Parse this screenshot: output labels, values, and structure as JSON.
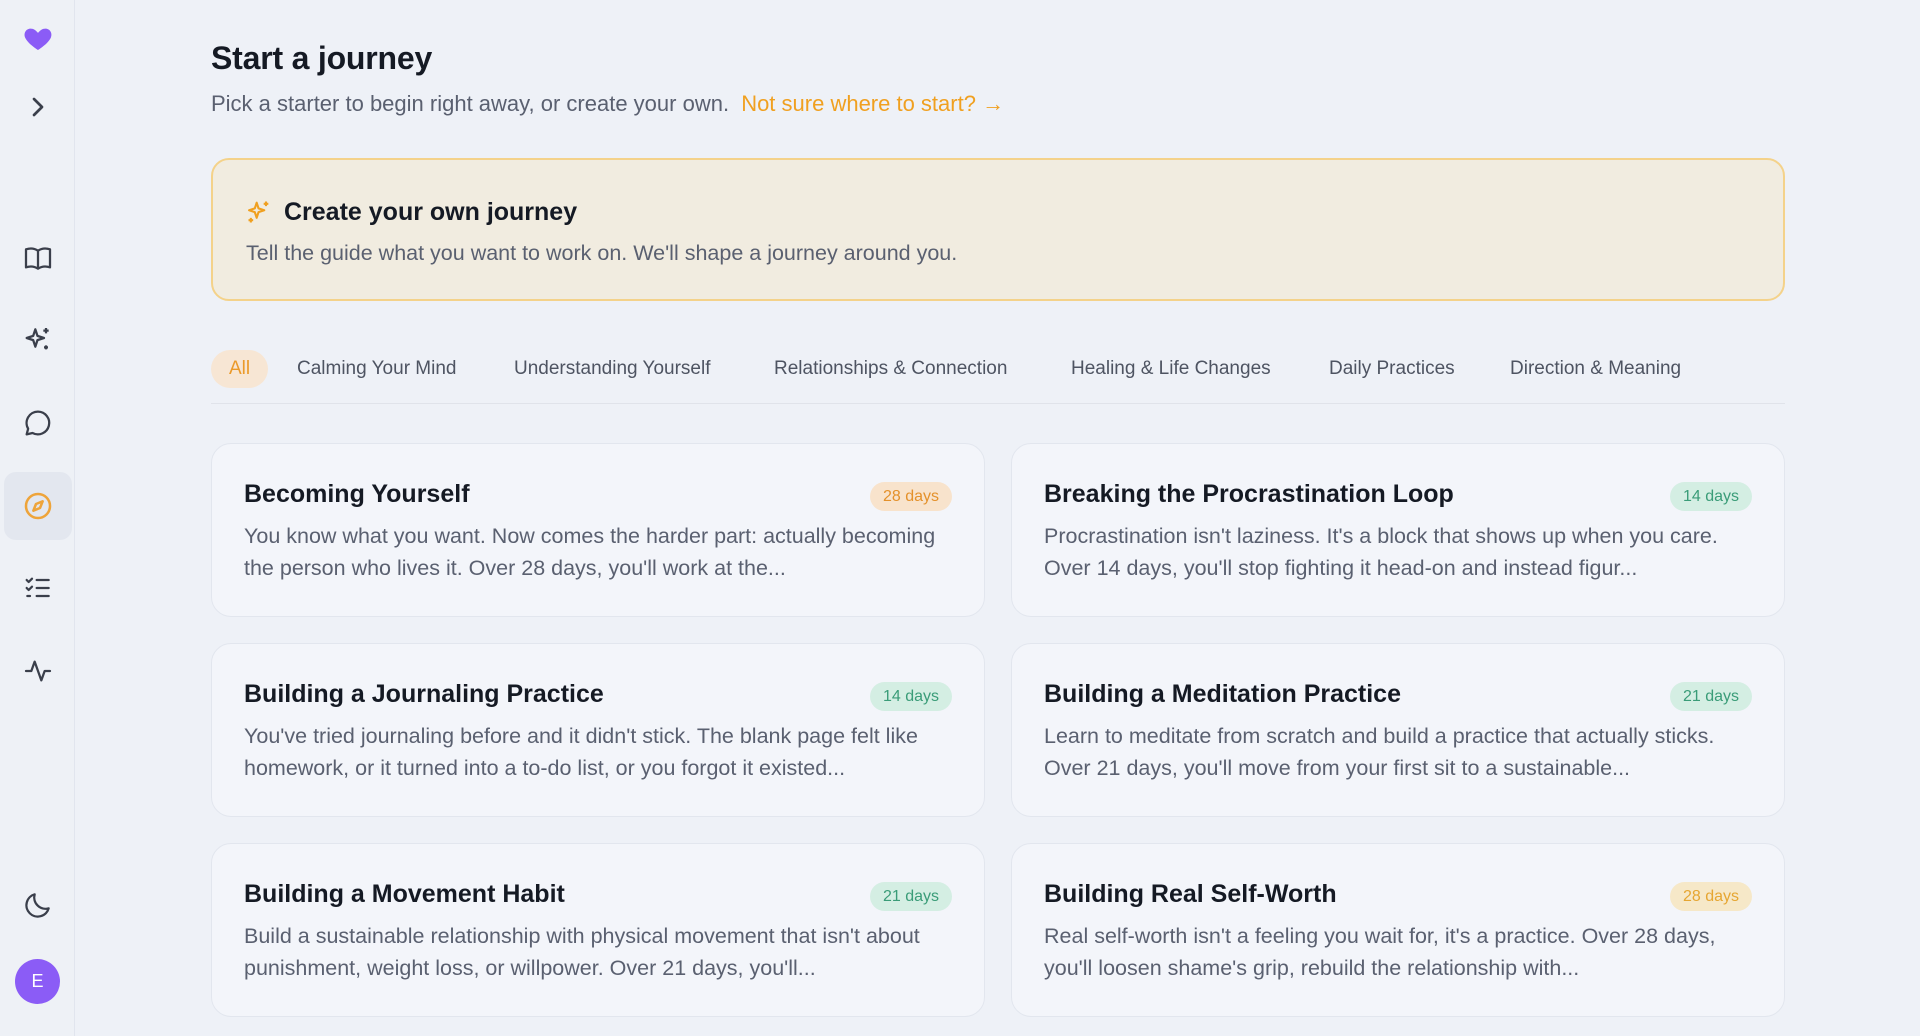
{
  "sidebar": {
    "items": [
      {
        "icon": "heart-logo-icon",
        "color": "#8b5cf6"
      },
      {
        "icon": "chevron-right-icon"
      },
      {
        "icon": "book-open-icon"
      },
      {
        "icon": "sparkles-icon"
      },
      {
        "icon": "chat-bubble-icon"
      },
      {
        "icon": "compass-icon",
        "active": true,
        "color": "#eea43a"
      },
      {
        "icon": "checklist-icon"
      },
      {
        "icon": "activity-icon"
      },
      {
        "icon": "moon-icon"
      }
    ],
    "avatar_initial": "E",
    "avatar_color": "#8b5cf6"
  },
  "header": {
    "title": "Start a journey",
    "subtitle": "Pick a starter to begin right away, or create your own.",
    "help_link": "Not sure where to start? →"
  },
  "create": {
    "title": "Create your own journey",
    "description": "Tell the guide what you want to work on. We'll shape a journey around you.",
    "accent": "#f4d28a"
  },
  "tabs": [
    {
      "label": "All",
      "active": true
    },
    {
      "label": "Calming Your Mind"
    },
    {
      "label": "Understanding Yourself"
    },
    {
      "label": "Relationships & Connection"
    },
    {
      "label": "Healing & Life Changes"
    },
    {
      "label": "Daily Practices"
    },
    {
      "label": "Direction & Meaning"
    }
  ],
  "journeys": [
    {
      "title": "Becoming Yourself",
      "badge": "28 days",
      "badge_color": "orange",
      "description": "You know what you want. Now comes the harder part: actually becoming the person who lives it. Over 28 days, you'll work at the..."
    },
    {
      "title": "Breaking the Procrastination Loop",
      "badge": "14 days",
      "badge_color": "green",
      "description": "Procrastination isn't laziness. It's a block that shows up when you care. Over 14 days, you'll stop fighting it head-on and instead figur..."
    },
    {
      "title": "Building a Journaling Practice",
      "badge": "14 days",
      "badge_color": "green",
      "description": "You've tried journaling before and it didn't stick. The blank page felt like homework, or it turned into a to-do list, or you forgot it existed..."
    },
    {
      "title": "Building a Meditation Practice",
      "badge": "21 days",
      "badge_color": "green",
      "description": "Learn to meditate from scratch and build a practice that actually sticks. Over 21 days, you'll move from your first sit to a sustainable..."
    },
    {
      "title": "Building a Movement Habit",
      "badge": "21 days",
      "badge_color": "green",
      "description": "Build a sustainable relationship with physical movement that isn't about punishment, weight loss, or willpower. Over 21 days, you'll..."
    },
    {
      "title": "Building Real Self-Worth",
      "badge": "28 days",
      "badge_color": "yellow",
      "description": "Real self-worth isn't a feeling you wait for, it's a practice. Over 28 days, you'll loosen shame's grip, rebuild the relationship with..."
    }
  ]
}
